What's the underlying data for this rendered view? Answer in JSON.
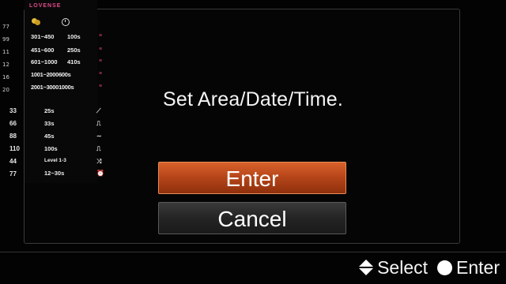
{
  "brand": "LOVENSE",
  "token_ranges": [
    {
      "range": "301~450",
      "time": "100s"
    },
    {
      "range": "451~600",
      "time": "250s"
    },
    {
      "range": "601~1000",
      "time": "410s"
    },
    {
      "range": "1001~2000",
      "time": "600s"
    },
    {
      "range": "2001~3000",
      "time": "1000s"
    }
  ],
  "modes": [
    {
      "value": "25s",
      "icon": "⟋"
    },
    {
      "value": "33s",
      "icon": "⎍"
    },
    {
      "value": "45s",
      "icon": "∼"
    },
    {
      "value": "100s",
      "icon": "⎍"
    },
    {
      "value": "Level 1-3",
      "icon": "⤨"
    },
    {
      "value": "12~30s",
      "icon": "⏰"
    }
  ],
  "side_numbers": [
    "33",
    "66",
    "88",
    "110",
    "44",
    "77"
  ],
  "side_labels": [
    "77",
    "99",
    "11",
    "12",
    "16",
    "20"
  ],
  "dialog": {
    "message": "Set Area/Date/Time.",
    "enter_label": "Enter",
    "cancel_label": "Cancel"
  },
  "footer": {
    "select_label": "Select",
    "enter_label": "Enter"
  },
  "colors": {
    "enter_button": "#b8461a",
    "cancel_button": "#242424",
    "brand": "#e04a8a",
    "background": "#030303"
  }
}
